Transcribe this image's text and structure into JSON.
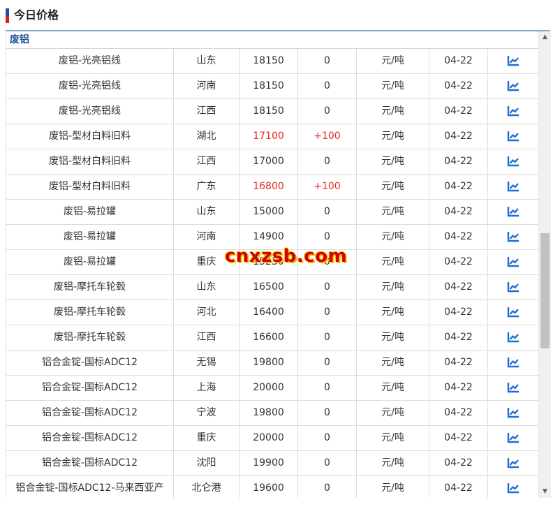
{
  "page": {
    "title": "今日价格",
    "watermark": "cnxzsb.com"
  },
  "colors": {
    "flag_blue": "#2251a5",
    "flag_red": "#d9201c",
    "header_line": "#8fa7cf",
    "section_text": "#1c4f9c",
    "rise_red": "#e52b2b",
    "chart_icon": "#1b6fd3"
  },
  "section": {
    "label": "废铝"
  },
  "row_icon": "trend-chart-icon",
  "table": {
    "rows": [
      {
        "name": "废铝-光亮铝线",
        "region": "山东",
        "price": "18150",
        "change": "0",
        "unit": "元/吨",
        "date": "04-22"
      },
      {
        "name": "废铝-光亮铝线",
        "region": "河南",
        "price": "18150",
        "change": "0",
        "unit": "元/吨",
        "date": "04-22"
      },
      {
        "name": "废铝-光亮铝线",
        "region": "江西",
        "price": "18150",
        "change": "0",
        "unit": "元/吨",
        "date": "04-22"
      },
      {
        "name": "废铝-型材白料旧料",
        "region": "湖北",
        "price": "17100",
        "change": "+100",
        "unit": "元/吨",
        "date": "04-22"
      },
      {
        "name": "废铝-型材白料旧料",
        "region": "江西",
        "price": "17000",
        "change": "0",
        "unit": "元/吨",
        "date": "04-22"
      },
      {
        "name": "废铝-型材白料旧料",
        "region": "广东",
        "price": "16800",
        "change": "+100",
        "unit": "元/吨",
        "date": "04-22"
      },
      {
        "name": "废铝-易拉罐",
        "region": "山东",
        "price": "15000",
        "change": "0",
        "unit": "元/吨",
        "date": "04-22"
      },
      {
        "name": "废铝-易拉罐",
        "region": "河南",
        "price": "14900",
        "change": "0",
        "unit": "元/吨",
        "date": "04-22"
      },
      {
        "name": "废铝-易拉罐",
        "region": "重庆",
        "price": "15250",
        "change": "0",
        "unit": "元/吨",
        "date": "04-22"
      },
      {
        "name": "废铝-摩托车轮毂",
        "region": "山东",
        "price": "16500",
        "change": "0",
        "unit": "元/吨",
        "date": "04-22"
      },
      {
        "name": "废铝-摩托车轮毂",
        "region": "河北",
        "price": "16400",
        "change": "0",
        "unit": "元/吨",
        "date": "04-22"
      },
      {
        "name": "废铝-摩托车轮毂",
        "region": "江西",
        "price": "16600",
        "change": "0",
        "unit": "元/吨",
        "date": "04-22"
      },
      {
        "name": "铝合金锭-国标ADC12",
        "region": "无锡",
        "price": "19800",
        "change": "0",
        "unit": "元/吨",
        "date": "04-22"
      },
      {
        "name": "铝合金锭-国标ADC12",
        "region": "上海",
        "price": "20000",
        "change": "0",
        "unit": "元/吨",
        "date": "04-22"
      },
      {
        "name": "铝合金锭-国标ADC12",
        "region": "宁波",
        "price": "19800",
        "change": "0",
        "unit": "元/吨",
        "date": "04-22"
      },
      {
        "name": "铝合金锭-国标ADC12",
        "region": "重庆",
        "price": "20000",
        "change": "0",
        "unit": "元/吨",
        "date": "04-22"
      },
      {
        "name": "铝合金锭-国标ADC12",
        "region": "沈阳",
        "price": "19900",
        "change": "0",
        "unit": "元/吨",
        "date": "04-22"
      },
      {
        "name": "铝合金锭-国标ADC12-马来西亚产",
        "region": "北仑港",
        "price": "19600",
        "change": "0",
        "unit": "元/吨",
        "date": "04-22"
      }
    ]
  }
}
